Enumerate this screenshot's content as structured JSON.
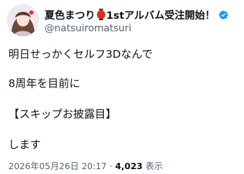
{
  "author": {
    "name_part1": "夏色まつり",
    "name_part2": "1stアルバム受注開始！",
    "handle": "@natsuiromatsuri"
  },
  "post": {
    "lines": [
      "明日せっかくセルフ3Dなんで",
      "8周年を目前に",
      "【スキップお披露目】",
      "します"
    ]
  },
  "meta": {
    "datetime": "2026年05月26日 20:17",
    "separator": "·",
    "views_count": "4,023",
    "views_label": "表示"
  },
  "icons": {
    "lantern": "red-lantern-emoji-icon",
    "verified": "verified-badge-icon"
  },
  "colors": {
    "verified_blue": "#1d9bf0",
    "secondary_text": "#536471",
    "primary_text": "#0f1419",
    "lantern_red": "#e0342b"
  }
}
